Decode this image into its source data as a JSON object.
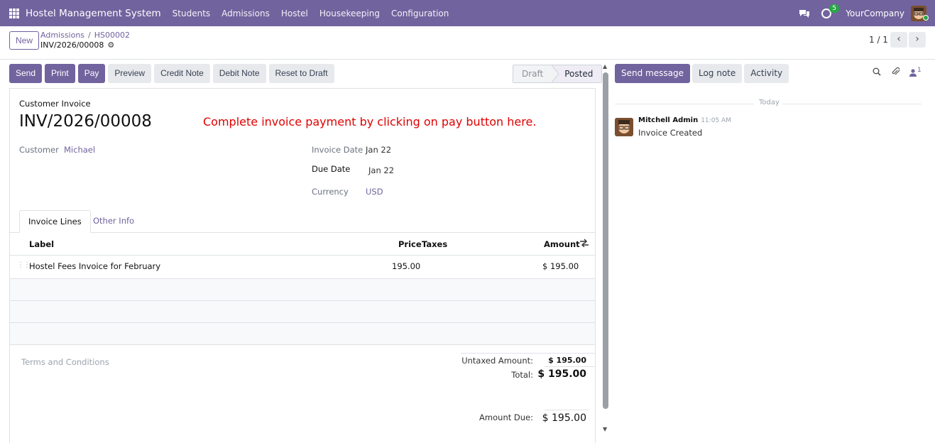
{
  "topbar": {
    "app_title": "Hostel Management System",
    "menu": [
      "Students",
      "Admissions",
      "Hostel",
      "Housekeeping",
      "Configuration"
    ],
    "activity_count": "5",
    "company": "YourCompany",
    "brand_color": "#71639e"
  },
  "control": {
    "new_label": "New",
    "breadcrumb": [
      "Admissions",
      "HS00002"
    ],
    "record_name": "INV/2026/00008",
    "pager": "1 / 1"
  },
  "statusbar": {
    "buttons": [
      "Send",
      "Print",
      "Pay",
      "Preview",
      "Credit Note",
      "Debit Note",
      "Reset to Draft"
    ],
    "steps": [
      "Draft",
      "Posted"
    ],
    "active_step": "Posted"
  },
  "invoice": {
    "type": "Customer Invoice",
    "number": "INV/2026/00008",
    "hint": "Complete invoice payment by clicking on pay button here.",
    "customer_label": "Customer",
    "customer": "Michael",
    "invoice_date_label": "Invoice Date",
    "invoice_date": "Jan 22",
    "due_date_label": "Due Date",
    "due_date": "Jan 22",
    "currency_label": "Currency",
    "currency": "USD"
  },
  "tabs": [
    "Invoice Lines",
    "Other Info"
  ],
  "lines": {
    "headers": {
      "label": "Label",
      "price": "Price",
      "taxes": "Taxes",
      "amount": "Amount"
    },
    "rows": [
      {
        "label": "Hostel Fees Invoice for February",
        "price": "195.00",
        "taxes": "",
        "amount": "$ 195.00"
      }
    ]
  },
  "footer": {
    "terms_placeholder": "Terms and Conditions",
    "untaxed_label": "Untaxed Amount:",
    "untaxed": "$ 195.00",
    "total_label": "Total:",
    "total": "$ 195.00",
    "amount_due_label": "Amount Due:",
    "amount_due": "$ 195.00"
  },
  "chatter": {
    "buttons": [
      "Send message",
      "Log note",
      "Activity"
    ],
    "followers_count": "1",
    "date_separator": "Today",
    "message": {
      "author": "Mitchell Admin",
      "time": "11:05 AM",
      "body": "Invoice Created"
    }
  }
}
